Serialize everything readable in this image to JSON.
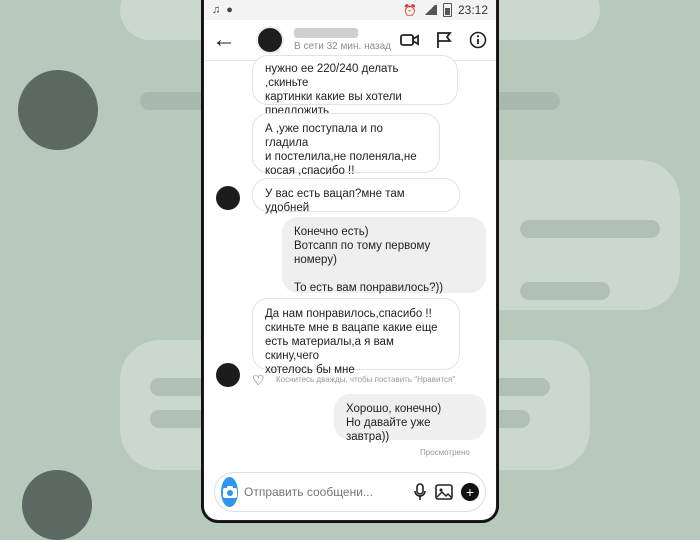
{
  "status_bar": {
    "time": "23:12"
  },
  "header": {
    "presence": "В сети 32 мин. назад"
  },
  "messages": [
    {
      "text": "нужно ее 220/240 делать ,скиньте\nкартинки какие вы хотели\nпредложить"
    },
    {
      "text": "А ,уже поступала и по гладила\nи постелила,не поленяла,не\nкосая ,спасибо !!"
    },
    {
      "text": "У вас есть вацап?мне там удобней"
    },
    {
      "text": "Конечно есть)\nВотсапп по тому первому номеру)\n\nТо есть вам понравилось?))"
    },
    {
      "text": "Да нам понравилось,спасибо !!\nскиньте мне в вацапе какие еще\nесть материалы,а я вам скину,чего\nхотелось бы мне"
    },
    {
      "text": "Хорошо, конечно)\nНо давайте уже завтра))"
    }
  ],
  "like_hint": "Коснитесь дважды, чтобы поставить \"Нравится\"",
  "seen_label": "Просмотрено",
  "composer": {
    "placeholder": "Отправить сообщени..."
  },
  "colors": {
    "camera_button": "#2f95ee",
    "incoming_bg": "#ffffff",
    "outgoing_bg": "#efefef"
  }
}
